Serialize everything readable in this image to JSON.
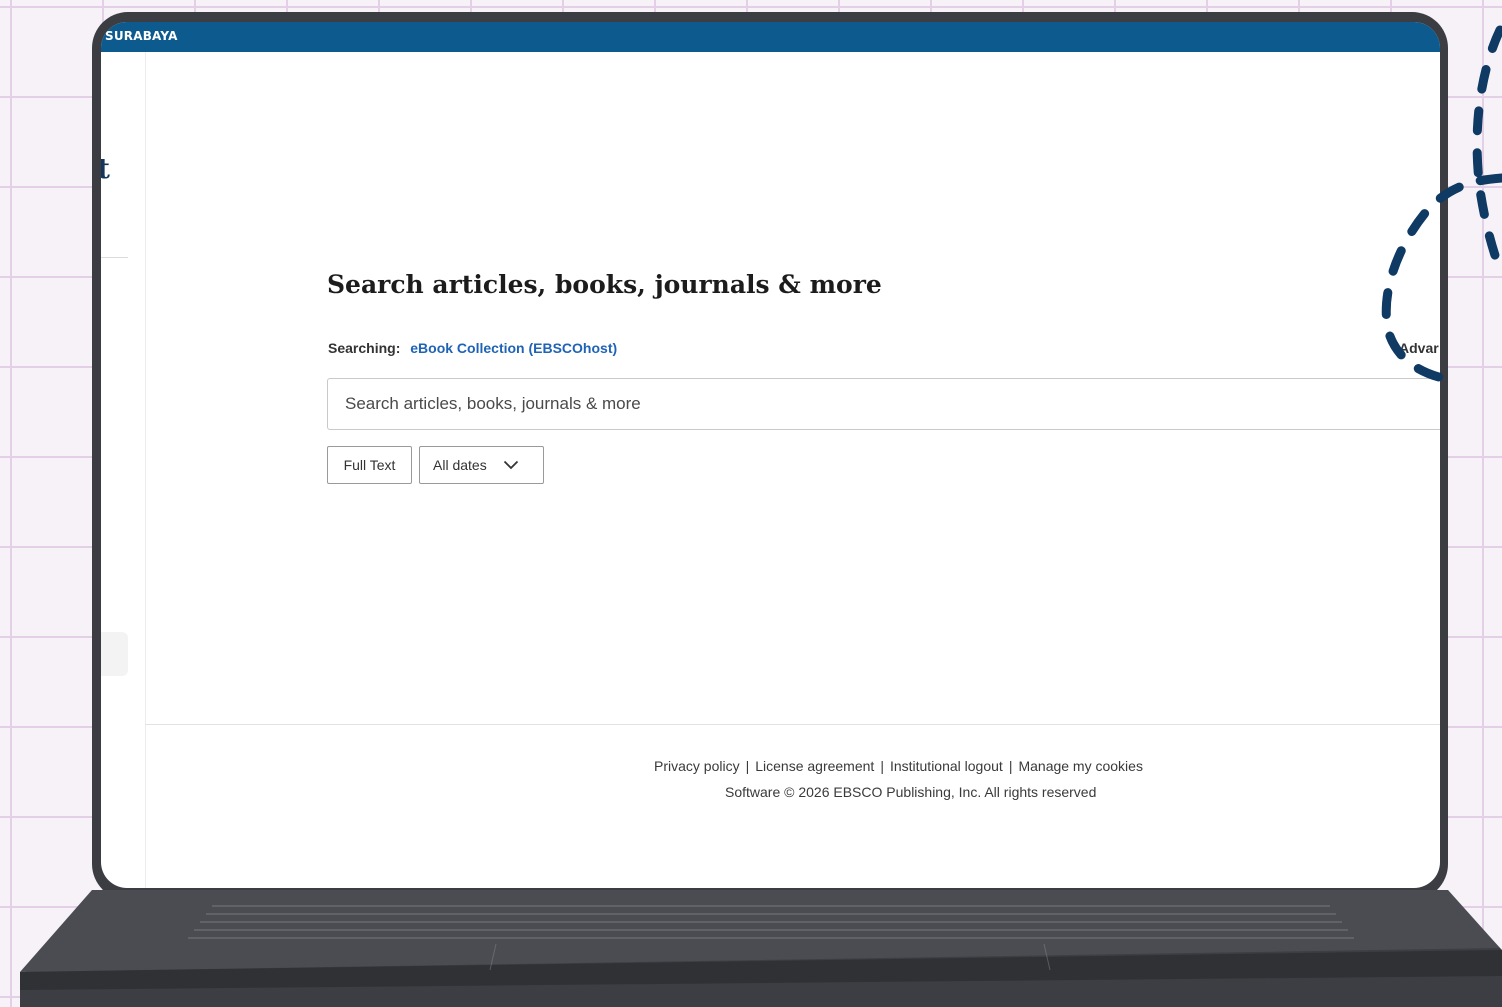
{
  "topbar": {
    "label": "SURABAYA"
  },
  "left_panel": {
    "glyph": "t"
  },
  "main": {
    "heading": "Search articles, books, journals & more",
    "searching_label": "Searching:",
    "searching_source": "eBook Collection (EBSCOhost)",
    "advanced_link": "Advar",
    "search": {
      "placeholder": "Search articles, books, journals & more",
      "value": ""
    },
    "filters": {
      "full_text_label": "Full Text",
      "dates_label": "All dates"
    }
  },
  "footer": {
    "links": [
      "Privacy policy",
      "License agreement",
      "Institutional logout",
      "Manage my cookies"
    ],
    "separator": "|",
    "copyright": "Software © 2026 EBSCO Publishing, Inc. All rights reserved"
  },
  "colors": {
    "topbar": "#0d5a8e",
    "link": "#1f63b6",
    "laptop": "#3b3d42",
    "dashes": "#0e3a63"
  }
}
